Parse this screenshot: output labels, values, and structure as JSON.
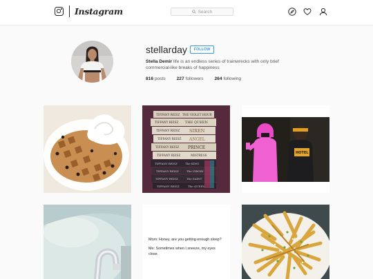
{
  "nav": {
    "wordmark": "Instagram",
    "search_placeholder": "Search",
    "icons": [
      "camera-logo-icon",
      "search-icon",
      "compass-icon",
      "heart-icon",
      "user-icon"
    ]
  },
  "profile": {
    "username": "stellarday",
    "follow_label": "FOLLOW",
    "full_name": "Stella Demir",
    "bio": "life is an endless series of trainwrecks with only brief commercial-like breaks of happiness",
    "stats": [
      {
        "count": "816",
        "label": "posts"
      },
      {
        "count": "227",
        "label": "followers"
      },
      {
        "count": "264",
        "label": "following"
      }
    ]
  },
  "posts": {
    "books": {
      "spines": [
        {
          "author": "TIFFANY REISZ",
          "title": "THE VIOLET HOUR"
        },
        {
          "author": "TIFFANY REISZ",
          "title": "THE QUEEN"
        },
        {
          "author": "TIFFANY REISZ",
          "title": "SIREN"
        },
        {
          "author": "TIFFANY REISZ",
          "title": "ANGEL"
        },
        {
          "author": "TIFFANY REISZ",
          "title": "PRINCE"
        },
        {
          "author": "TIFFANY REISZ",
          "title": "MISTRESS"
        },
        {
          "author": "TIFFANY REISZ",
          "title": "The KING"
        },
        {
          "author": "TIFFANY REISZ",
          "title": "The VIRGIN"
        },
        {
          "author": "TIFFANY REISZ",
          "title": "The SAINT"
        },
        {
          "author": "TIFFANY REISZ",
          "title": "The QUEEN"
        }
      ]
    },
    "quote": {
      "line1": "Mom: Honey, are you getting enough sleep?",
      "line2": "Me: Sometimes when I sneeze, my eyes close."
    }
  },
  "colors": {
    "accent": "#3897f0",
    "border": "#e6e6e6",
    "background": "#fafafa"
  }
}
